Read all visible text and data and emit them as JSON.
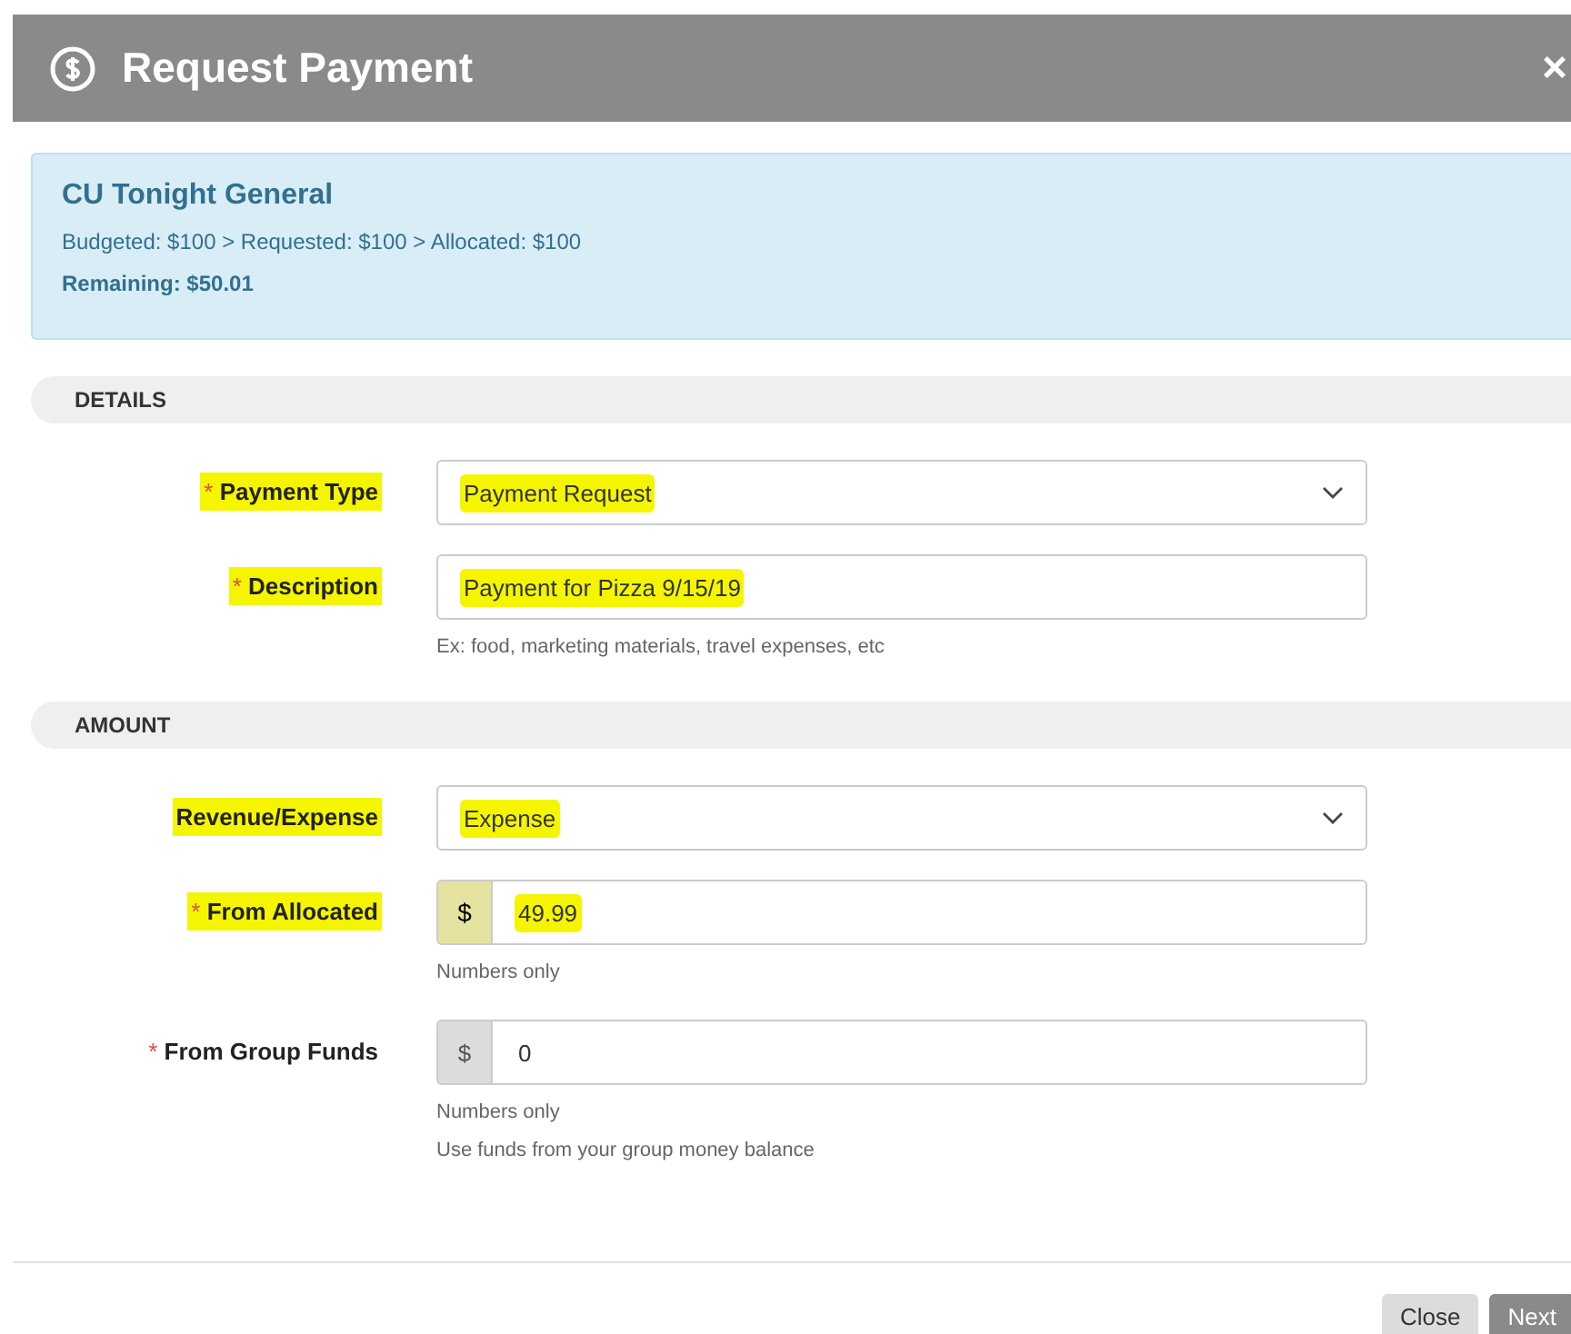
{
  "dialog": {
    "title": "Request Payment",
    "close": "×"
  },
  "budget": {
    "name": "CU Tonight General",
    "summary": "Budgeted: $100 > Requested: $100 > Allocated: $100",
    "remaining": "Remaining: $50.01"
  },
  "sections": [
    {
      "title": "DETAILS",
      "fields": [
        {
          "kind": "select",
          "label": "Payment Type",
          "required_mark": "*",
          "value": "Payment Request",
          "label_highlighted": true,
          "value_highlighted": true
        },
        {
          "kind": "text",
          "label": "Description",
          "required_mark": "*",
          "value": "Payment for Pizza 9/15/19",
          "label_highlighted": true,
          "value_highlighted": true,
          "help": [
            "Ex: food, marketing materials, travel expenses, etc"
          ]
        }
      ]
    },
    {
      "title": "AMOUNT",
      "fields": [
        {
          "kind": "select",
          "label": "Revenue/Expense",
          "value": "Expense",
          "label_highlighted": true,
          "value_highlighted": true
        },
        {
          "kind": "currency",
          "label": "From Allocated",
          "required_mark": "*",
          "prefix": "$",
          "value": "49.99",
          "label_highlighted": true,
          "value_highlighted": true,
          "help": [
            "Numbers only"
          ]
        },
        {
          "kind": "currency",
          "label": "From Group Funds",
          "required_mark": "*",
          "prefix": "$",
          "value": "0",
          "label_highlighted": false,
          "value_highlighted": false,
          "help": [
            "Numbers only",
            "Use funds from your group money balance"
          ]
        }
      ]
    }
  ],
  "buttons": [
    {
      "label": "Close",
      "kind": "secondary"
    },
    {
      "label": "Next",
      "kind": "primary"
    }
  ]
}
